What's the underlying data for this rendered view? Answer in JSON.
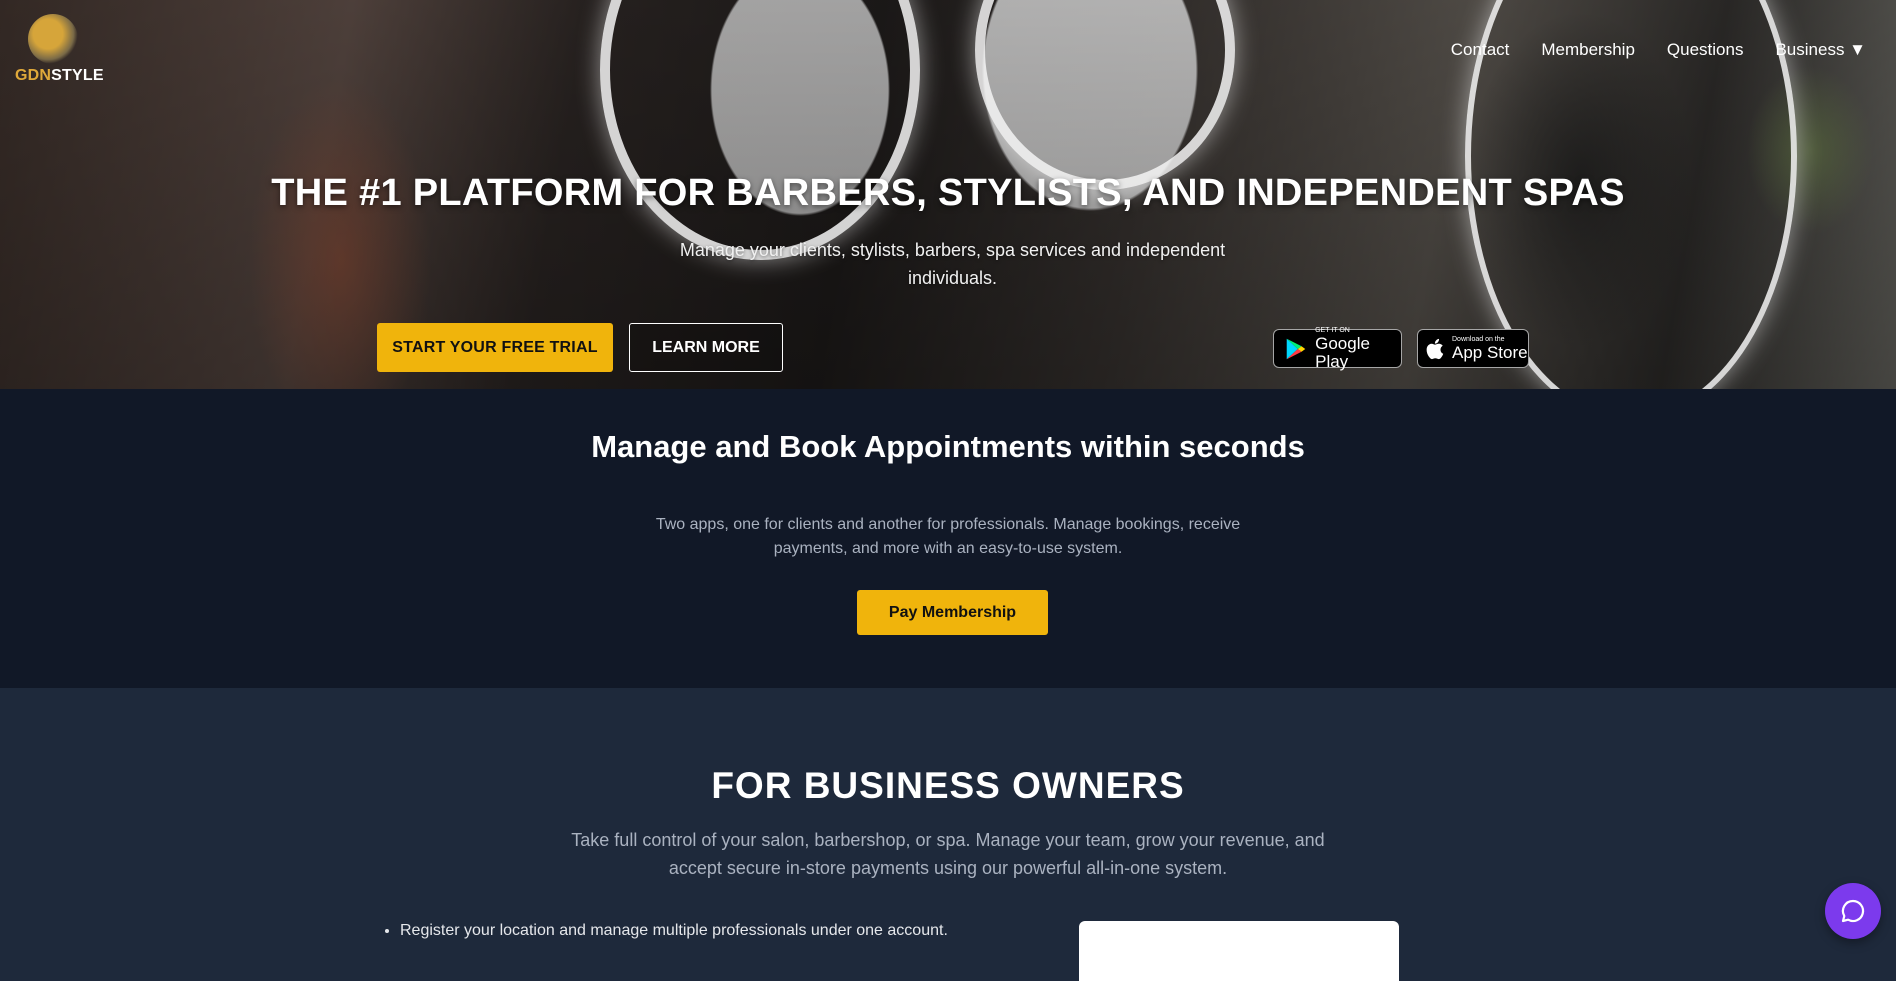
{
  "brand": {
    "part1": "GDN",
    "part2": "STYLE"
  },
  "nav": {
    "contact": "Contact",
    "membership": "Membership",
    "questions": "Questions",
    "business": "Business ▼"
  },
  "hero": {
    "title": "THE #1 PLATFORM FOR BARBERS, STYLISTS, AND INDEPENDENT SPAS",
    "subtitle": "Manage your clients, stylists, barbers, spa services and independent individuals.",
    "trial_button": "START YOUR FREE TRIAL",
    "learn_button": "LEARN MORE",
    "google_play": {
      "small": "GET IT ON",
      "big": "Google Play"
    },
    "app_store": {
      "small": "Download on the",
      "big": "App Store"
    }
  },
  "booking": {
    "title": "Manage and Book Appointments within seconds",
    "text": "Two apps, one for clients and another for professionals. Manage bookings, receive payments, and more with an easy-to-use system.",
    "pay_button": "Pay Membership"
  },
  "owners": {
    "title": "FOR BUSINESS OWNERS",
    "text": "Take full control of your salon, barbershop, or spa. Manage your team, grow your revenue, and accept secure in-store payments using our powerful all-in-one system.",
    "items": [
      "Register your location and manage multiple professionals under one account."
    ]
  },
  "colors": {
    "accent": "#f0b40c",
    "dark_section": "#111827",
    "slate_section": "#1e293b",
    "chat": "#7c3aed"
  }
}
